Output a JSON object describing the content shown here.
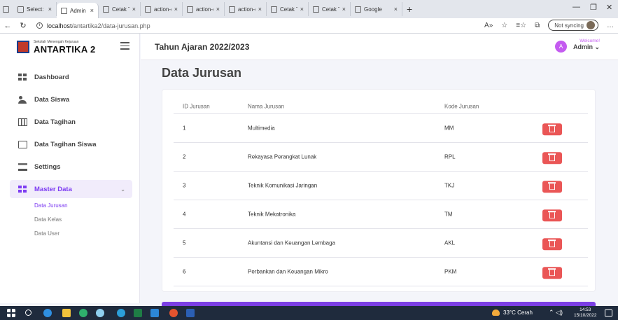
{
  "browser": {
    "tabs": [
      {
        "label": "Select: da",
        "active": false
      },
      {
        "label": "Admin Pa",
        "active": true
      },
      {
        "label": "Cetak Tag",
        "active": false
      },
      {
        "label": "action-ex",
        "active": false
      },
      {
        "label": "action-ex",
        "active": false
      },
      {
        "label": "action-ex",
        "active": false
      },
      {
        "label": "Cetak Tag",
        "active": false
      },
      {
        "label": "Cetak Tag",
        "active": false
      },
      {
        "label": "Google",
        "active": false
      }
    ],
    "close_glyph": "×",
    "new_tab_glyph": "+",
    "url_host": "localhost",
    "url_path": "/antartika2/data-jurusan.php",
    "sync_label": "Not syncing"
  },
  "sidebar": {
    "brand_small": "Sekolah Menengah Kejuruan",
    "brand_big": "ANTARTIKA 2",
    "menu": [
      {
        "label": "Dashboard",
        "icon": "dashboard-icon"
      },
      {
        "label": "Data Siswa",
        "icon": "users-icon"
      },
      {
        "label": "Data Tagihan",
        "icon": "table-icon"
      },
      {
        "label": "Data Tagihan Siswa",
        "icon": "document-icon"
      },
      {
        "label": "Settings",
        "icon": "layers-icon"
      }
    ],
    "master": {
      "label": "Master Data",
      "chevron": "⌄"
    },
    "submenu": [
      "Data Jurusan",
      "Data Kelas",
      "Data User"
    ]
  },
  "header": {
    "year_label": "Tahun Ajaran 2022/2023",
    "avatar_letter": "A",
    "welcome": "Welcome!",
    "user": "Admin ⌄"
  },
  "main": {
    "title": "Data Jurusan",
    "columns": [
      "ID Jurusan",
      "Nama Jurusan",
      "Kode Jurusan"
    ],
    "rows": [
      {
        "id": "1",
        "nama": "Multimedia",
        "kode": "MM"
      },
      {
        "id": "2",
        "nama": "Rekayasa Perangkat Lunak",
        "kode": "RPL"
      },
      {
        "id": "3",
        "nama": "Teknik Komunikasi Jaringan",
        "kode": "TKJ"
      },
      {
        "id": "4",
        "nama": "Teknik Mekatronika",
        "kode": "TM"
      },
      {
        "id": "5",
        "nama": "Akuntansi dan Keuangan Lembaga",
        "kode": "AKL"
      },
      {
        "id": "6",
        "nama": "Perbankan dan Keuangan Mikro",
        "kode": "PKM"
      }
    ]
  },
  "taskbar": {
    "weather": "33°C Cerah",
    "time": "14:53",
    "date": "15/10/2022"
  },
  "colors": {
    "accent": "#7d3cf2",
    "danger": "#ea5656",
    "taskbar": "#1f2b3d"
  }
}
